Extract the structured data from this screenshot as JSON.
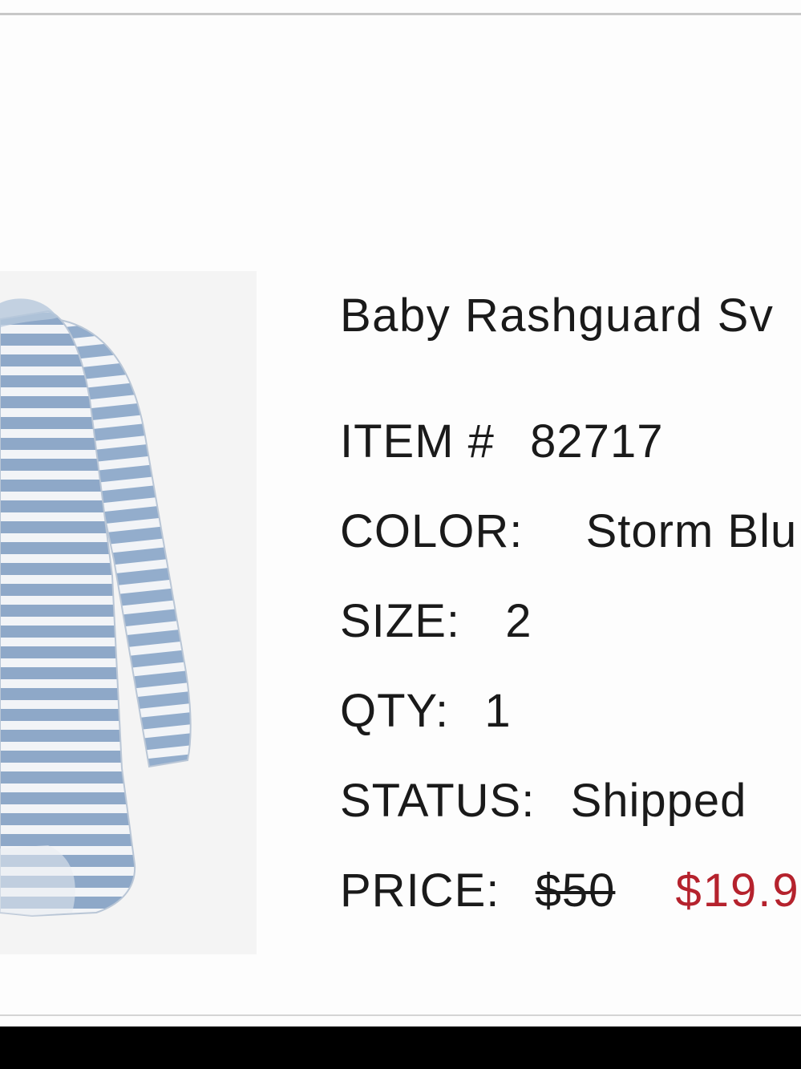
{
  "product": {
    "name": "Baby Rashguard Sv",
    "image_alt": "striped baby rashguard swimsuit",
    "colors": {
      "stripe_blue": "#8ea8c8",
      "stripe_white": "#f2f4f7",
      "image_background": "#f4f4f4"
    }
  },
  "details": {
    "item_label": "ITEM #",
    "item_number": "82717",
    "color_label": "COLOR:",
    "color_value": "Storm Blu",
    "size_label": "SIZE:",
    "size_value": "2",
    "qty_label": "QTY:",
    "qty_value": "1",
    "status_label": "STATUS:",
    "status_value": "Shipped",
    "price_label": "PRICE:",
    "original_price": "$50",
    "sale_price": "$19.9"
  },
  "theme": {
    "text_color": "#1a1a1a",
    "sale_color": "#b5222d",
    "background": "#fdfdfd"
  }
}
